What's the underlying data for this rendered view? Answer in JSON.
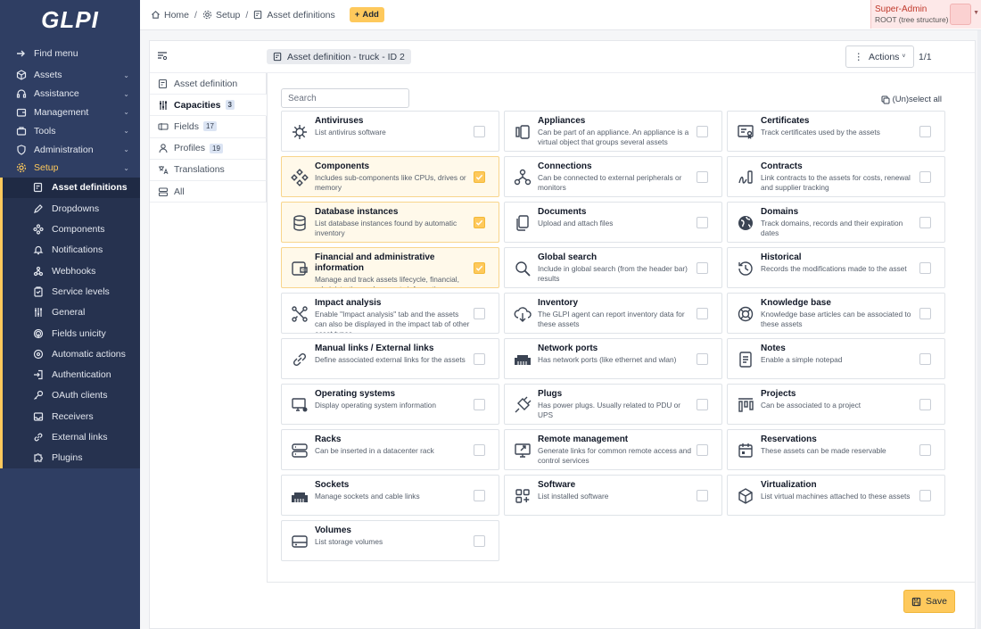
{
  "app": {
    "logo": "GLPI"
  },
  "sidebar": {
    "find_menu": "Find menu",
    "sections": [
      {
        "label": "Assets",
        "icon": "cube-icon"
      },
      {
        "label": "Assistance",
        "icon": "headset-icon"
      },
      {
        "label": "Management",
        "icon": "wallet-icon"
      },
      {
        "label": "Tools",
        "icon": "briefcase-icon"
      },
      {
        "label": "Administration",
        "icon": "shield-icon"
      },
      {
        "label": "Setup",
        "icon": "gear-icon"
      }
    ],
    "setup_items": [
      {
        "label": "Asset definitions",
        "icon": "asset-def-icon"
      },
      {
        "label": "Dropdowns",
        "icon": "edit-icon"
      },
      {
        "label": "Components",
        "icon": "components-icon"
      },
      {
        "label": "Notifications",
        "icon": "bell-icon"
      },
      {
        "label": "Webhooks",
        "icon": "webhook-icon"
      },
      {
        "label": "Service levels",
        "icon": "clipboard-icon"
      },
      {
        "label": "General",
        "icon": "sliders-icon"
      },
      {
        "label": "Fields unicity",
        "icon": "fingerprint-icon"
      },
      {
        "label": "Automatic actions",
        "icon": "automatic-icon"
      },
      {
        "label": "Authentication",
        "icon": "login-icon"
      },
      {
        "label": "OAuth clients",
        "icon": "key-icon"
      },
      {
        "label": "Receivers",
        "icon": "inbox-icon"
      },
      {
        "label": "External links",
        "icon": "link-icon"
      },
      {
        "label": "Plugins",
        "icon": "puzzle-icon"
      }
    ]
  },
  "breadcrumb": {
    "home": "Home",
    "setup": "Setup",
    "asset_definitions": "Asset definitions",
    "add": "Add"
  },
  "profile": {
    "name": "Super-Admin",
    "entity": "ROOT (tree structure)"
  },
  "header": {
    "title": "Asset definition - truck - ID 2",
    "actions": "Actions",
    "pager": "1/1"
  },
  "tabs": [
    {
      "label": "Asset definition",
      "badge": ""
    },
    {
      "label": "Capacities",
      "badge": "3"
    },
    {
      "label": "Fields",
      "badge": "17"
    },
    {
      "label": "Profiles",
      "badge": "19"
    },
    {
      "label": "Translations",
      "badge": ""
    },
    {
      "label": "All",
      "badge": ""
    }
  ],
  "capacities": {
    "search_placeholder": "Search",
    "unselect_all": "(Un)select all",
    "save": "Save",
    "items": [
      {
        "title": "Antiviruses",
        "desc": "List antivirus software",
        "checked": false,
        "icon": "virus-icon"
      },
      {
        "title": "Appliances",
        "desc": "Can be part of an appliance. An appliance is a virtual object that groups several assets",
        "checked": false,
        "icon": "appliance-icon"
      },
      {
        "title": "Certificates",
        "desc": "Track certificates used by the assets",
        "checked": false,
        "icon": "certificate-icon"
      },
      {
        "title": "Components",
        "desc": "Includes sub-components like CPUs, drives or memory",
        "checked": true,
        "icon": "components-icon"
      },
      {
        "title": "Connections",
        "desc": "Can be connected to external peripherals or monitors",
        "checked": false,
        "icon": "connection-icon"
      },
      {
        "title": "Contracts",
        "desc": "Link contracts to the assets for costs, renewal and supplier tracking",
        "checked": false,
        "icon": "contract-icon"
      },
      {
        "title": "Database instances",
        "desc": "List database instances found by automatic inventory",
        "checked": true,
        "icon": "database-icon"
      },
      {
        "title": "Documents",
        "desc": "Upload and attach files",
        "checked": false,
        "icon": "documents-icon"
      },
      {
        "title": "Domains",
        "desc": "Track domains, records and their expiration dates",
        "checked": false,
        "icon": "globe-icon"
      },
      {
        "title": "Financial and administrative information",
        "desc": "Manage and track assets lifecycle, financial, administrative and warranty information",
        "checked": true,
        "icon": "wallet-icon"
      },
      {
        "title": "Global search",
        "desc": "Include in global search (from the header bar) results",
        "checked": false,
        "icon": "search-icon"
      },
      {
        "title": "Historical",
        "desc": "Records the modifications made to the asset",
        "checked": false,
        "icon": "history-icon"
      },
      {
        "title": "Impact analysis",
        "desc": "Enable \"Impact analysis\" tab and the assets can also be displayed in the impact tab of other asset types",
        "checked": false,
        "icon": "impact-icon"
      },
      {
        "title": "Inventory",
        "desc": "The GLPI agent can report inventory data for these assets",
        "checked": false,
        "icon": "cloud-download-icon"
      },
      {
        "title": "Knowledge base",
        "desc": "Knowledge base articles can be associated to these assets",
        "checked": false,
        "icon": "lifebuoy-icon"
      },
      {
        "title": "Manual links / External links",
        "desc": "Define associated external links for the assets",
        "checked": false,
        "icon": "link-icon"
      },
      {
        "title": "Network ports",
        "desc": "Has network ports (like ethernet and wlan)",
        "checked": false,
        "icon": "network-icon"
      },
      {
        "title": "Notes",
        "desc": "Enable a simple notepad",
        "checked": false,
        "icon": "notes-icon"
      },
      {
        "title": "Operating systems",
        "desc": "Display operating system information",
        "checked": false,
        "icon": "os-icon"
      },
      {
        "title": "Plugs",
        "desc": "Has power plugs. Usually related to PDU or UPS",
        "checked": false,
        "icon": "plug-icon"
      },
      {
        "title": "Projects",
        "desc": "Can be associated to a project",
        "checked": false,
        "icon": "projects-icon"
      },
      {
        "title": "Racks",
        "desc": "Can be inserted in a datacenter rack",
        "checked": false,
        "icon": "rack-icon"
      },
      {
        "title": "Remote management",
        "desc": "Generate links for common remote access and control services",
        "checked": false,
        "icon": "remote-icon"
      },
      {
        "title": "Reservations",
        "desc": "These assets can be made reservable",
        "checked": false,
        "icon": "calendar-icon"
      },
      {
        "title": "Sockets",
        "desc": "Manage sockets and cable links",
        "checked": false,
        "icon": "socket-icon"
      },
      {
        "title": "Software",
        "desc": "List installed software",
        "checked": false,
        "icon": "software-icon"
      },
      {
        "title": "Virtualization",
        "desc": "List virtual machines attached to these assets",
        "checked": false,
        "icon": "box-icon"
      },
      {
        "title": "Volumes",
        "desc": "List storage volumes",
        "checked": false,
        "icon": "volume-icon"
      }
    ]
  },
  "colors": {
    "sidebar": "#2f3e63",
    "accent": "#fec95c",
    "checked_bg": "#fff9ea"
  }
}
